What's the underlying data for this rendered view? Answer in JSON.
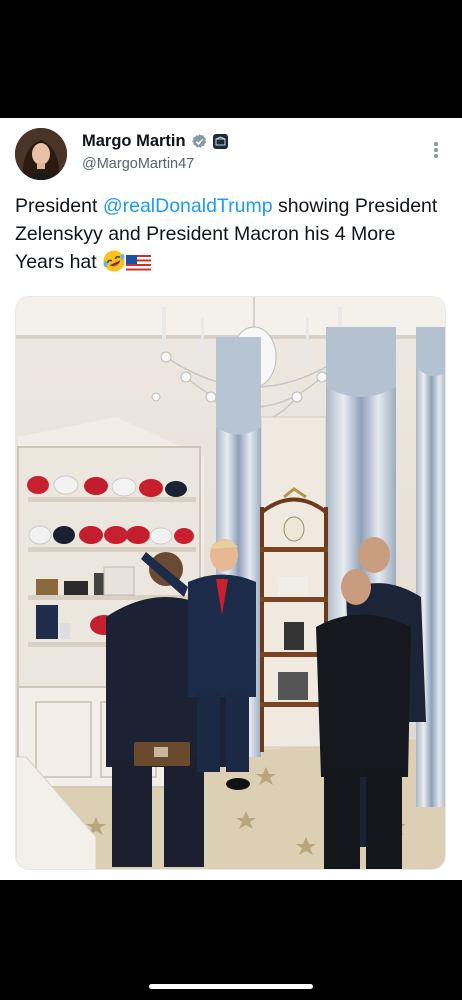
{
  "tweet": {
    "author": {
      "display_name": "Margo Martin",
      "handle": "@MargoMartin47",
      "verified_icon": "verified-badge-icon",
      "affiliation_icon": "government-affiliation-badge-icon"
    },
    "text": {
      "prefix": "President ",
      "mention": "@realDonaldTrump",
      "suffix": " showing President Zelenskyy and President Macron his 4 More Years hat",
      "emojis": [
        "rolling-on-floor-laughing-emoji",
        "us-flag-emoji"
      ]
    },
    "media": {
      "type": "photo"
    }
  },
  "colors": {
    "link": "#1d9bf0",
    "text": "#0f1419",
    "secondary": "#536471",
    "verified": "#829aab"
  }
}
